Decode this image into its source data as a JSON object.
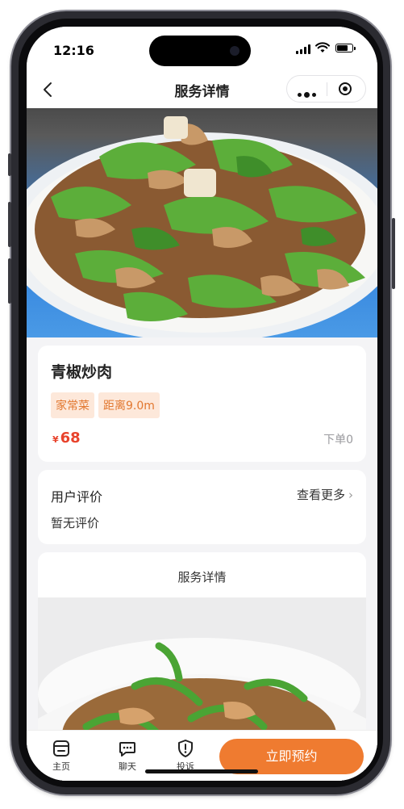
{
  "status_bar": {
    "time": "12:16"
  },
  "nav": {
    "title": "服务详情",
    "back_icon": "chevron-left-icon",
    "more_icon": "more-dots-icon",
    "close_icon": "target-close-icon"
  },
  "hero": {
    "image": "green-pepper-stir-fried-pork-photo"
  },
  "dish": {
    "name": "青椒炒肉",
    "tags": [
      "家常菜",
      "距离9.0m"
    ],
    "currency": "¥",
    "price": "68",
    "orders": "下单0"
  },
  "reviews": {
    "title": "用户评价",
    "more": "查看更多",
    "empty": "暂无评价"
  },
  "service": {
    "title": "服务详情",
    "image": "dish-in-white-bowl-photo"
  },
  "tabbar": {
    "items": [
      {
        "label": "主页",
        "icon": "shop-icon"
      },
      {
        "label": "聊天",
        "icon": "chat-icon"
      },
      {
        "label": "投诉",
        "icon": "shield-alert-icon"
      }
    ],
    "book_label": "立即预约"
  },
  "colors": {
    "accent": "#ef7b30",
    "price": "#e8432c",
    "tag_bg": "#fde8da",
    "tag_text": "#e2772f"
  }
}
